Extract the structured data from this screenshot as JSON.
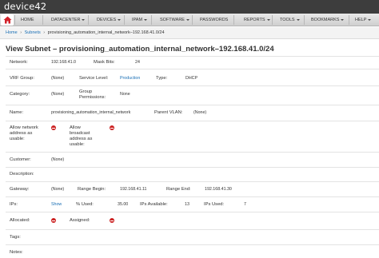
{
  "app": {
    "brand": "device42"
  },
  "nav": {
    "items": [
      {
        "label": "HOME",
        "dropdown": false
      },
      {
        "label": "DATACENTER",
        "dropdown": true
      },
      {
        "label": "DEVICES",
        "dropdown": true
      },
      {
        "label": "IPAM",
        "dropdown": true
      },
      {
        "label": "SOFTWARE",
        "dropdown": true
      },
      {
        "label": "PASSWORDS",
        "dropdown": false
      },
      {
        "label": "REPORTS",
        "dropdown": true
      },
      {
        "label": "TOOLS",
        "dropdown": true
      },
      {
        "label": "BOOKMARKS",
        "dropdown": true
      },
      {
        "label": "HELP",
        "dropdown": true
      }
    ]
  },
  "breadcrumb": {
    "home": "Home",
    "subnets": "Subnets",
    "current": "provisioning_automation_internal_network–192.168.41.0/24",
    "separator": "›"
  },
  "page": {
    "title": "View Subnet – provisioning_automation_internal_network–192.168.41.0/24"
  },
  "fields": {
    "network": {
      "label": "Network:",
      "value": "192.168.41.0"
    },
    "mask_bits": {
      "label": "Mask Bits:",
      "value": "24"
    },
    "vrf_group": {
      "label": "VRF Group:",
      "value": "(None)"
    },
    "service_level": {
      "label": "Service Level:",
      "value": "Production"
    },
    "type": {
      "label": "Type:",
      "value": "DHCP"
    },
    "category": {
      "label": "Category:",
      "value": "(None)"
    },
    "group_permissions": {
      "label_line1": "Group",
      "label_line2": "Permissions:",
      "value": "None"
    },
    "name": {
      "label": "Name:",
      "value": "provisioning_automation_internal_network"
    },
    "parent_vlan": {
      "label": "Parent VLAN:",
      "value": "(None)"
    },
    "allow_network": {
      "label_line1": "Allow network",
      "label_line2": "address as",
      "label_line3": "usable:"
    },
    "allow_broadcast": {
      "label_line1": "Allow",
      "label_line2": "broadcast",
      "label_line3": "address as",
      "label_line4": "usable:"
    },
    "customer": {
      "label": "Customer:",
      "value": "(None)"
    },
    "description": {
      "label": "Description:"
    },
    "gateway": {
      "label": "Gateway:",
      "value": "(None)"
    },
    "range_begin": {
      "label": "Range Begin:",
      "value": "192.168.41.11"
    },
    "range_end": {
      "label": "Range End:",
      "value": "192.168.41.30"
    },
    "ips": {
      "label": "IPs:",
      "link": "Show"
    },
    "pct_used": {
      "label": "% Used:",
      "value": "35.00"
    },
    "ips_available": {
      "label": "IPs Available:",
      "value": "13"
    },
    "ips_used": {
      "label": "IPs Used:",
      "value": "7"
    },
    "allocated": {
      "label": "Allocated:"
    },
    "assigned": {
      "label": "Assigned:"
    },
    "tags": {
      "label": "Tags:"
    },
    "notes": {
      "label": "Notes:"
    }
  },
  "colors": {
    "topbar": "#3d3d3d",
    "link": "#1a6fb5",
    "no_icon": "#cc2222",
    "home_icon": "#d2222a"
  }
}
